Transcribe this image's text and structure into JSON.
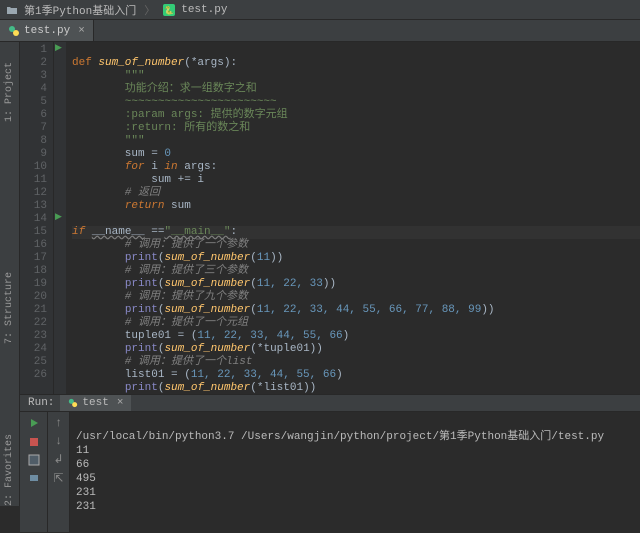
{
  "titlebar": {
    "folder_icon": "folder",
    "folder": "第1季Python基础入门",
    "file_icon": "python",
    "file": "test.py"
  },
  "tab": {
    "file": "test.py",
    "close": "×"
  },
  "rails": {
    "project": "1: Project",
    "structure": "7: Structure",
    "favorites": "2: Favorites"
  },
  "gutter": [
    "1",
    "2",
    "3",
    "4",
    "5",
    "6",
    "7",
    "8",
    "9",
    "10",
    "11",
    "12",
    "13",
    "14",
    "15",
    "16",
    "17",
    "18",
    "19",
    "20",
    "21",
    "22",
    "23",
    "24",
    "25",
    "26"
  ],
  "code": {
    "l1_def": "def ",
    "l1_fn": "sum_of_number",
    "l1_rest": "(*args):",
    "l2": "        \"\"\"",
    "l3": "        功能介绍：求一组数字之和",
    "l4": "        ~~~~~~~~~~~~~~~~~~~~~~~",
    "l5": "        :param args: 提供的数字元组",
    "l6": "        :return: 所有的数之和",
    "l7": "        \"\"\"",
    "l8_a": "        sum = ",
    "l8_b": "0",
    "l9_a": "        ",
    "l9_for": "for ",
    "l9_i": "i ",
    "l9_in": "in ",
    "l9_args": "args:",
    "l10_a": "            sum += i",
    "l11": "        # 返回",
    "l12_a": "        ",
    "l12_ret": "return ",
    "l12_b": "sum",
    "l13": "",
    "l14_a": "if ",
    "l14_name": "__name__",
    "l14_eq": " ==",
    "l14_str": "\"__main__\"",
    "l14_c": ":",
    "l15": "        # 调用：提供了一个参数",
    "l16_a": "        ",
    "l16_p": "print",
    "l16_b": "(",
    "l16_fn": "sum_of_number",
    "l16_c": "(",
    "l16_n": "11",
    "l16_d": "))",
    "l17": "        # 调用：提供了三个参数",
    "l18_a": "        ",
    "l18_p": "print",
    "l18_b": "(",
    "l18_fn": "sum_of_number",
    "l18_c": "(",
    "l18_n": "11, 22, 33",
    "l18_d": "))",
    "l19": "        # 调用：提供了九个参数",
    "l20_a": "        ",
    "l20_p": "print",
    "l20_b": "(",
    "l20_fn": "sum_of_number",
    "l20_c": "(",
    "l20_n": "11, 22, 33, 44, 55, 66, 77, 88, 99",
    "l20_d": "))",
    "l21": "        # 调用：提供了一个元组",
    "l22_a": "        tuple01 = (",
    "l22_n": "11, 22, 33, 44, 55, 66",
    "l22_b": ")",
    "l23_a": "        ",
    "l23_p": "print",
    "l23_b": "(",
    "l23_fn": "sum_of_number",
    "l23_c": "(*tuple01))",
    "l24": "        # 调用：提供了一个list",
    "l25_a": "        list01 = (",
    "l25_n": "11, 22, 33, 44, 55, 66",
    "l25_b": ")",
    "l26_a": "        ",
    "l26_p": "print",
    "l26_b": "(",
    "l26_fn": "sum_of_number",
    "l26_c": "(*list01))"
  },
  "run": {
    "label": "Run:",
    "tab": "test",
    "tab_close": "×",
    "cmd": "/usr/local/bin/python3.7 /Users/wangjin/python/project/第1季Python基础入门/test.py",
    "out": [
      "11",
      "66",
      "495",
      "231",
      "231"
    ]
  }
}
